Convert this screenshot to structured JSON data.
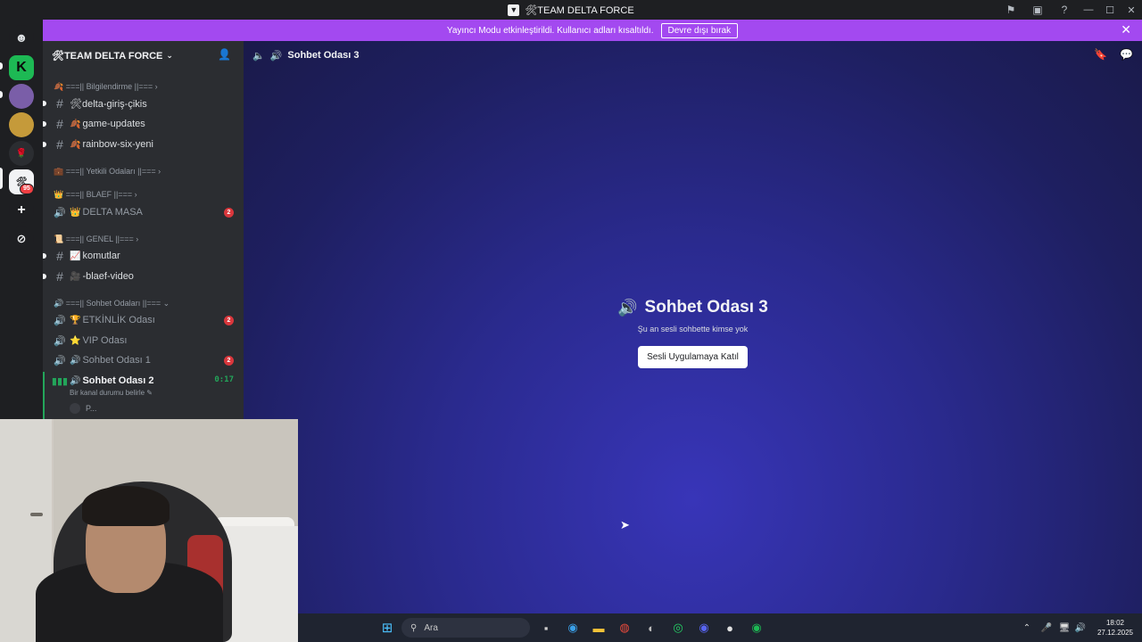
{
  "window": {
    "title": "🛠TEAM DELTA FORCE"
  },
  "banner": {
    "text": "Yayıncı Modu etkinleştirildi. Kullanıcı adları kısaltıldı.",
    "button": "Devre dışı bırak"
  },
  "server": {
    "name": "🛠TEAM DELTA FORCE"
  },
  "categories": [
    {
      "label": "🍂 ===|| Bilgilendirme ||=== ›"
    },
    {
      "label": "💼 ===|| Yetkili Odaları ||=== ›"
    },
    {
      "label": "👑 ===|| BLAEF ||=== ›"
    },
    {
      "label": "📜 ===|| GENEL ||=== ›"
    },
    {
      "label": "🔊 ===|| Sohbet Odaları ||=== ⌄"
    }
  ],
  "channels": {
    "delta_giris": {
      "label": "🛠delta-giriş-çikis"
    },
    "game_updates": {
      "emoji": "🍂",
      "label": "game-updates"
    },
    "rainbow": {
      "emoji": "🍂",
      "label": "rainbow-six-yeni"
    },
    "delta_masa": {
      "emoji": "👑",
      "label": "DELTA MASA",
      "badge": "2"
    },
    "komutlar": {
      "emoji": "📈",
      "label": "komutlar"
    },
    "blaef_video": {
      "emoji": "🎥",
      "label": "-blaef-video"
    },
    "etkinlik": {
      "emoji": "🏆",
      "label": "ETKİNLİK Odası",
      "badge": "2"
    },
    "vip": {
      "emoji": "⭐",
      "label": "VIP Odası"
    },
    "sohbet1": {
      "emoji": "🔊",
      "label": "Sohbet Odası 1",
      "badge": "2"
    },
    "sohbet2": {
      "emoji": "🔊",
      "label": "Sohbet Odası 2",
      "timer": "0:17",
      "status": "Bir kanal durumu belirle",
      "user": "P..."
    }
  },
  "main": {
    "channel_name": "Sohbet Odası 3",
    "room_title": "Sohbet Odası 3",
    "empty_text": "Şu an sesli sohbette kimse yok",
    "join_button": "Sesli Uygulamaya Katıl"
  },
  "guilds": {
    "badge": "95"
  },
  "taskbar": {
    "search_placeholder": "Ara",
    "time": "18:02",
    "date": "27.12.2025"
  },
  "colors": {
    "banner": "#a349f0",
    "voice_active": "#23a55a",
    "badge": "#da373c",
    "sidebar": "#2b2d31",
    "guildbar": "#1e1f22"
  }
}
